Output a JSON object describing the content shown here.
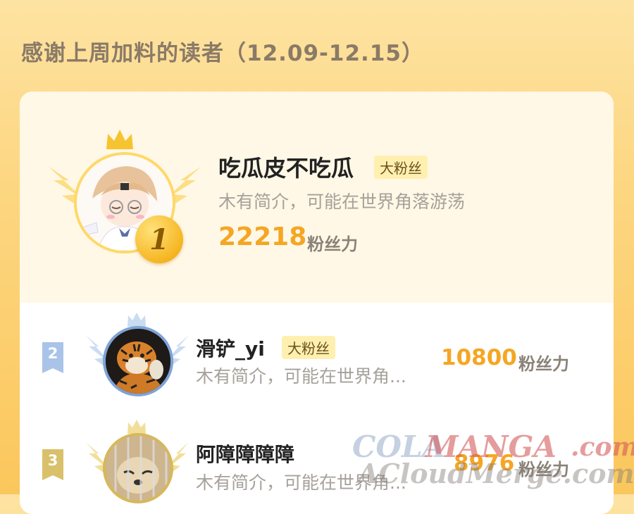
{
  "page": {
    "title": "感谢上周加料的读者（12.09-12.15）"
  },
  "ranking": [
    {
      "rank": "1",
      "name": "吃瓜皮不吃瓜",
      "tag": "大粉丝",
      "bio": "木有简介，可能在世界角落游荡",
      "score": "22218",
      "unit": "粉丝力"
    },
    {
      "rank": "2",
      "name": "滑铲_yi",
      "tag": "大粉丝",
      "bio": "木有简介，可能在世界角...",
      "score": "10800",
      "unit": "粉丝力"
    },
    {
      "rank": "3",
      "name": "阿障障障障",
      "tag": "",
      "bio": "木有简介，可能在世界角...",
      "score": "8976",
      "unit": "粉丝力"
    }
  ],
  "watermark": {
    "line1_a": "COLA",
    "line1_b": "MANGA",
    "line1_c": ".com",
    "line2": "ACloudMerge.com"
  },
  "colors": {
    "accent": "#f5a623",
    "rank2": "#8fb3e0",
    "rank3": "#d9bd5c",
    "background": "#fdd783"
  }
}
